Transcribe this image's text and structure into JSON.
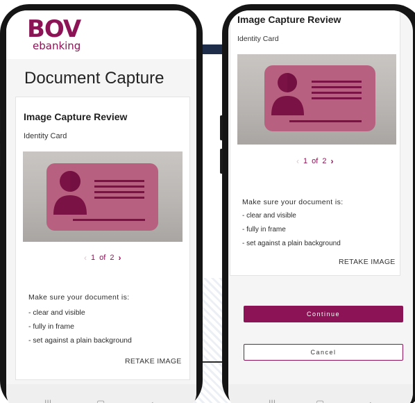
{
  "colors": {
    "brand": "#8c1456",
    "card_pink": "#b7607f",
    "screen_bg": "#f5f5f5"
  },
  "brand": {
    "mark": "BOV",
    "sub": "ebanking"
  },
  "phone1": {
    "page_title": "Document Capture",
    "card_title": "Image Capture Review",
    "doc_type": "Identity Card",
    "pager": {
      "current": "1",
      "of": "of",
      "total": "2"
    },
    "instructions": {
      "heading": "Make sure your document is:",
      "items": [
        "- clear and visible",
        "- fully in frame",
        "- set against a plain background"
      ]
    },
    "retake_label": "RETAKE IMAGE"
  },
  "phone2": {
    "card_title": "Image Capture Review",
    "doc_type": "Identity Card",
    "pager": {
      "current": "1",
      "of": "of",
      "total": "2"
    },
    "instructions": {
      "heading": "Make sure your document is:",
      "items": [
        "- clear and visible",
        "- fully in frame",
        "- set against a plain background"
      ]
    },
    "retake_label": "RETAKE IMAGE",
    "continue_label": "Continue",
    "cancel_label": "Cancel"
  },
  "icons": {
    "prev": "chevron-left-icon",
    "next": "chevron-right-icon",
    "recents": "recents-icon",
    "home": "home-icon",
    "back": "back-icon"
  }
}
